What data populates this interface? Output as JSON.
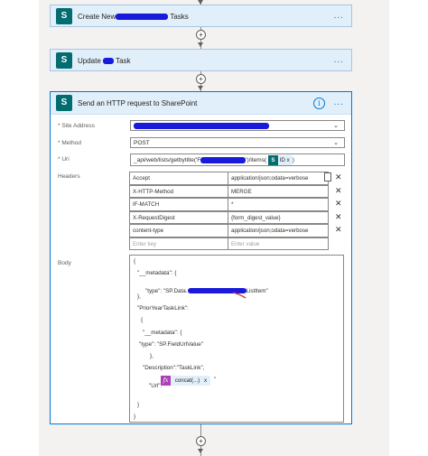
{
  "colors": {
    "accent": "#0078d4",
    "sharepoint": "#036c70",
    "function": "#ae3fb7",
    "redaction": "#1a1adb"
  },
  "steps": [
    {
      "icon": "sharepoint-icon",
      "title_prefix": "Create New",
      "title_suffix": "Tasks"
    },
    {
      "icon": "sharepoint-icon",
      "title_prefix": "Update",
      "title_suffix": "Task"
    }
  ],
  "step_menu": "...",
  "add_step": "+",
  "action": {
    "title": "Send an HTTP request to SharePoint",
    "info": "i",
    "menu": "...",
    "fields": {
      "site_address_label": "* Site Address",
      "method_label": "* Method",
      "method_value": "POST",
      "uri_label": "* Uri",
      "uri_value": "_api/web/lists/getbytitle('F",
      "uri_value_tail": "')/items(",
      "uri_token": "ID",
      "uri_token_close": "x",
      "uri_end": ")",
      "headers_label": "Headers",
      "body_label": "Body"
    },
    "headers": [
      {
        "key": "Accept",
        "value": "application/json;odata=verbose"
      },
      {
        "key": "X-HTTP-Method",
        "value": "MERGE"
      },
      {
        "key": "IF-MATCH",
        "value": "*"
      },
      {
        "key": "X-RequestDigest",
        "value": "{form_digest_value}"
      },
      {
        "key": "content-type",
        "value": "application/json;odata=verbose"
      }
    ],
    "header_placeholder": {
      "key": "Enter key",
      "value": "Enter value"
    },
    "remove": "✕",
    "body": {
      "l1": "{",
      "l2": "\"__metadata\": {",
      "l3_a": "\"type\": \"SP.Data.",
      "l3_b": "ListItem\"",
      "l4": "},",
      "l5": "\"PriorYearTaskLink\":",
      "l6": "{",
      "l7": "\"__metadata\": {",
      "l8": "\"type\": \"SP.FieldUrlValue\"",
      "l9": "},",
      "l10": "\"Description\":\"TaskLink\",",
      "l11": "\"Url\":\"",
      "l11_end": "\"",
      "token_icon": "fx",
      "token_label": "concat(...)",
      "token_close": "x",
      "l12": "}",
      "l13": "}"
    }
  }
}
